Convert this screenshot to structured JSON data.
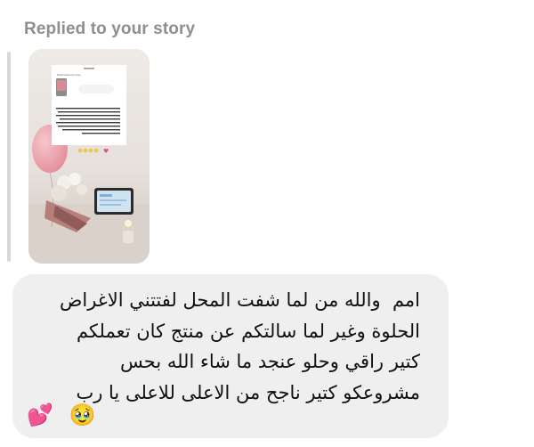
{
  "reply": {
    "header": "Replied to your story"
  },
  "story": {
    "screenshot_title": "Rainbowfrenzy.store",
    "screenshot_heart": "♥"
  },
  "message": {
    "text": "امم  والله من لما شفت المحل لفتتني الاغراض\nالحلوة وغير لما سالتكم عن منتج كان تعملكم\nكتير راقي وحلو عنجد ما شاء الله بحس\nمشروعكو كتير ناجح من الاعلى للاعلى يا رب",
    "emojis": [
      "💕",
      "🥹"
    ]
  },
  "colors": {
    "header": "#8e8e93",
    "bubble": "#efeff0",
    "text": "#111111"
  }
}
